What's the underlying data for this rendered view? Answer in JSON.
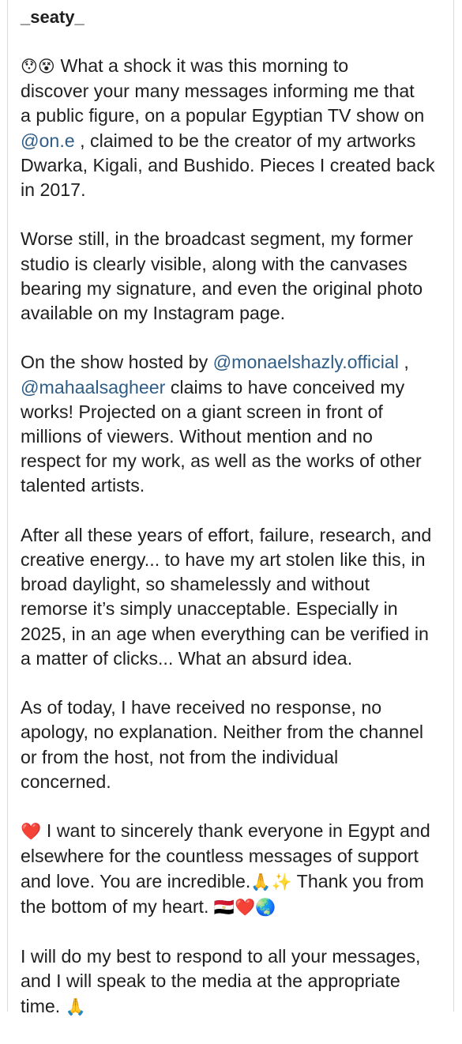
{
  "post": {
    "username": "_seaty_",
    "paragraphs": [
      {
        "segments": [
          {
            "type": "emoji",
            "text": "😯😵 "
          },
          {
            "type": "text",
            "text": "What a shock it was this morning to\ndiscover your many messages informing me that\na public figure, on a popular Egyptian TV show on\n"
          },
          {
            "type": "mention",
            "text": "@on.e"
          },
          {
            "type": "text",
            "text": " , claimed to be the creator of my artworks\nDwarka, Kigali, and Bushido. Pieces I created back\nin 2017."
          }
        ]
      },
      {
        "segments": [
          {
            "type": "text",
            "text": "Worse still, in the broadcast segment, my former\nstudio is clearly visible, along with the canvases\nbearing my signature, and even the original photo\navailable on my Instagram page."
          }
        ]
      },
      {
        "segments": [
          {
            "type": "text",
            "text": "On the show hosted by "
          },
          {
            "type": "mention",
            "text": "@monaelshazly.official"
          },
          {
            "type": "text",
            "text": " ,\n"
          },
          {
            "type": "mention",
            "text": "@mahaalsagheer"
          },
          {
            "type": "text",
            "text": " claims to have conceived my\nworks! Projected on a giant screen in front of\nmillions of viewers. Without mention and no\nrespect for my work, as well as the works of other\ntalented artists."
          }
        ]
      },
      {
        "segments": [
          {
            "type": "text",
            "text": "After all these years of effort, failure, research, and\ncreative energy... to have my art stolen like this, in\nbroad daylight, so shamelessly and without\nremorse it’s simply unacceptable. Especially in\n2025, in an age when everything can be verified in\na matter of clicks... What an absurd idea."
          }
        ]
      },
      {
        "segments": [
          {
            "type": "text",
            "text": "As of today, I have received no response, no\napology, no explanation. Neither from the channel\nor from the host, not from the individual\nconcerned."
          }
        ]
      },
      {
        "segments": [
          {
            "type": "emoji",
            "text": "❤️ "
          },
          {
            "type": "text",
            "text": "I want to sincerely thank everyone in Egypt and\nelsewhere for the countless messages of support\nand love. You are incredible."
          },
          {
            "type": "emoji",
            "text": "🙏✨"
          },
          {
            "type": "text",
            "text": " Thank you from\nthe bottom of my heart. "
          },
          {
            "type": "emoji",
            "text": "🇪🇬❤️🌏"
          }
        ]
      },
      {
        "segments": [
          {
            "type": "text",
            "text": "I will do my best to respond to all your messages,\nand I will speak to the media at the appropriate\ntime. "
          },
          {
            "type": "emoji",
            "text": "🙏"
          }
        ]
      }
    ]
  },
  "colors": {
    "mention": "#2f5d86",
    "text": "#1f1f1f",
    "border": "#d9d9d9"
  }
}
